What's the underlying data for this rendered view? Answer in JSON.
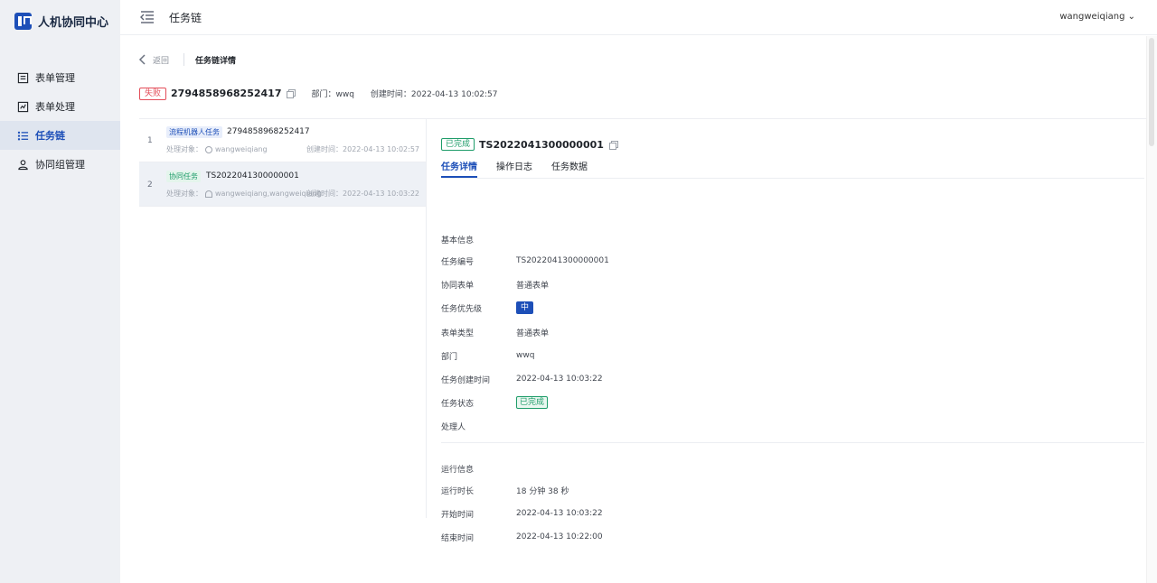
{
  "app": {
    "title": "人机协同中心"
  },
  "sidebar": {
    "items": [
      {
        "label": "表单管理",
        "icon": "form-icon"
      },
      {
        "label": "表单处理",
        "icon": "form-process-icon"
      },
      {
        "label": "任务链",
        "icon": "task-chain-icon",
        "active": true
      },
      {
        "label": "协同组管理",
        "icon": "group-icon"
      }
    ]
  },
  "topbar": {
    "title": "任务链",
    "user": "wangweiqiang"
  },
  "breadcrumb": {
    "back": "返回",
    "current": "任务链详情"
  },
  "chain": {
    "status": "失败",
    "id": "2794858968252417",
    "dept": "部门：wwq",
    "created": "创建时间：2022-04-13 10:02:57"
  },
  "tasks": [
    {
      "index": "1",
      "type": "流程机器人任务",
      "code": "2794858968252417",
      "handler": "处理对象：",
      "handler_value": "wangweiqiang",
      "created": "创建时间：2022-04-13 10:02:57"
    },
    {
      "index": "2",
      "type": "协同任务",
      "code": "TS2022041300000001",
      "handler": "处理对象：",
      "handler_value": "wangweiqiang,wangweiqiang",
      "created": "创建时间：2022-04-13 10:03:22"
    }
  ],
  "detail": {
    "status": "已完成",
    "id": "TS2022041300000001",
    "tabs": [
      "任务详情",
      "操作日志",
      "任务数据"
    ],
    "basic_title": "基本信息",
    "fields": [
      {
        "label": "任务编号",
        "value": "TS2022041300000001"
      },
      {
        "label": "协同表单",
        "value": "普通表单"
      },
      {
        "label": "任务优先级",
        "value": "中"
      },
      {
        "label": "表单类型",
        "value": "普通表单"
      },
      {
        "label": "部门",
        "value": "wwq"
      },
      {
        "label": "任务创建时间",
        "value": "2022-04-13 10:03:22"
      },
      {
        "label": "任务状态",
        "value": "已完成"
      },
      {
        "label": "处理人",
        "value": ""
      }
    ],
    "run_title": "运行信息",
    "run_fields": [
      {
        "label": "运行时长",
        "value": "18 分钟 38 秒"
      },
      {
        "label": "开始时间",
        "value": "2022-04-13 10:03:22"
      },
      {
        "label": "结束时间",
        "value": "2022-04-13 10:22:00"
      }
    ]
  },
  "colors": {
    "primary": "#1d4fb8",
    "success": "#1f9d6a",
    "danger": "#e34d59",
    "sidebar_bg": "#eef0f4"
  }
}
